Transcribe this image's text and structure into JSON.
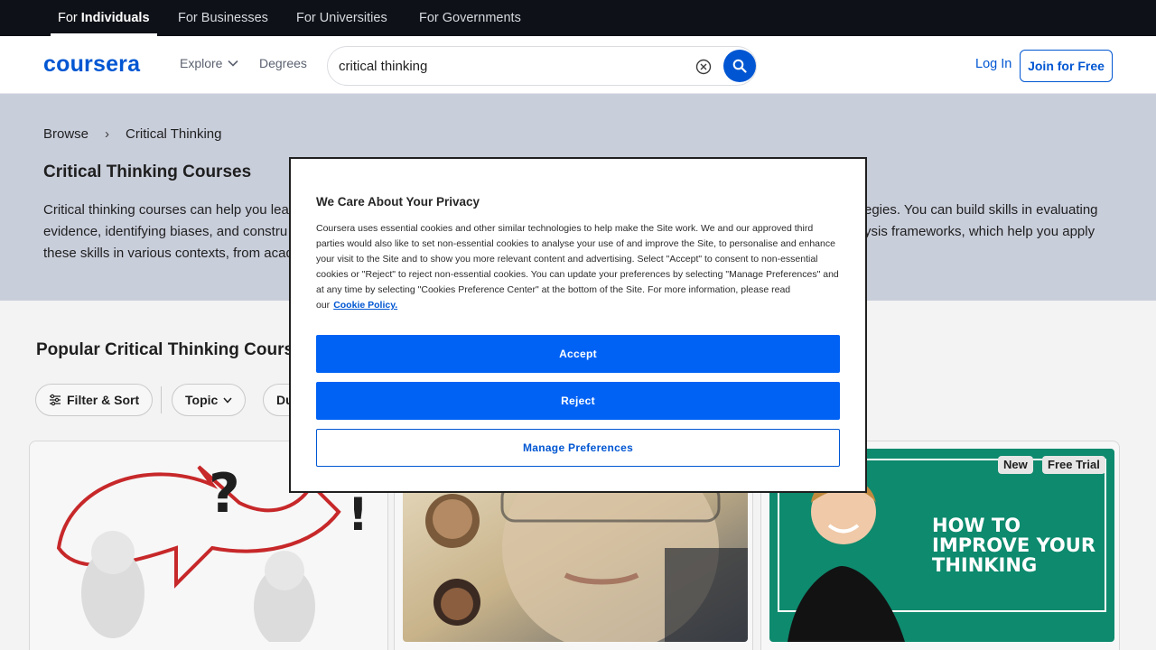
{
  "audience_tabs": [
    {
      "label_prefix": "For ",
      "label_strong": "Individuals"
    },
    {
      "label": "For Businesses"
    },
    {
      "label": "For Universities"
    },
    {
      "label": "For Governments"
    }
  ],
  "header": {
    "logo": "coursera",
    "explore_label": "Explore",
    "degrees_label": "Degrees",
    "search_value": "critical thinking",
    "login_label": "Log In",
    "join_label": "Join for Free"
  },
  "breadcrumb": [
    "Browse",
    "Critical Thinking"
  ],
  "page_title": "Critical Thinking Courses",
  "description_lines": [
    "Critical thinking courses can help you lea",
    "evidence, identifying biases, and constru",
    "these skills in various contexts, from acad"
  ],
  "description_right_lines": [
    "egies. You can build skills in evaluating",
    "ysis frameworks, which help you apply"
  ],
  "section_title": "Popular Critical Thinking Courses",
  "filters": {
    "filter_sort_label": "Filter & Sort",
    "topic_label": "Topic",
    "duration_partial": "Du"
  },
  "card_badges": [
    "New",
    "Free Trial"
  ],
  "card3_image_text": [
    "HOW TO",
    "IMPROVE YOUR",
    "THINKING"
  ],
  "modal": {
    "title": "We Care About Your Privacy",
    "body": "Coursera uses essential cookies and other similar technologies to help make the Site work. We and our approved third parties would also like to set non-essential cookies to analyse your use of and improve the Site, to personalise and enhance your visit to the Site and to show you more relevant content and advertising. Select \"Accept\" to consent to non-essential cookies or \"Reject\" to reject non-essential cookies. You can update your preferences by selecting \"Manage Preferences\" and at any time by selecting \"Cookies Preference Center\" at the bottom of the Site. For more information, please read our",
    "link_label": "Cookie Policy.",
    "accept_label": "Accept",
    "reject_label": "Reject",
    "manage_label": "Manage Preferences"
  },
  "colors": {
    "brand": "#0056d2",
    "consent_button": "#0062f5",
    "topbar": "#0e1117"
  }
}
